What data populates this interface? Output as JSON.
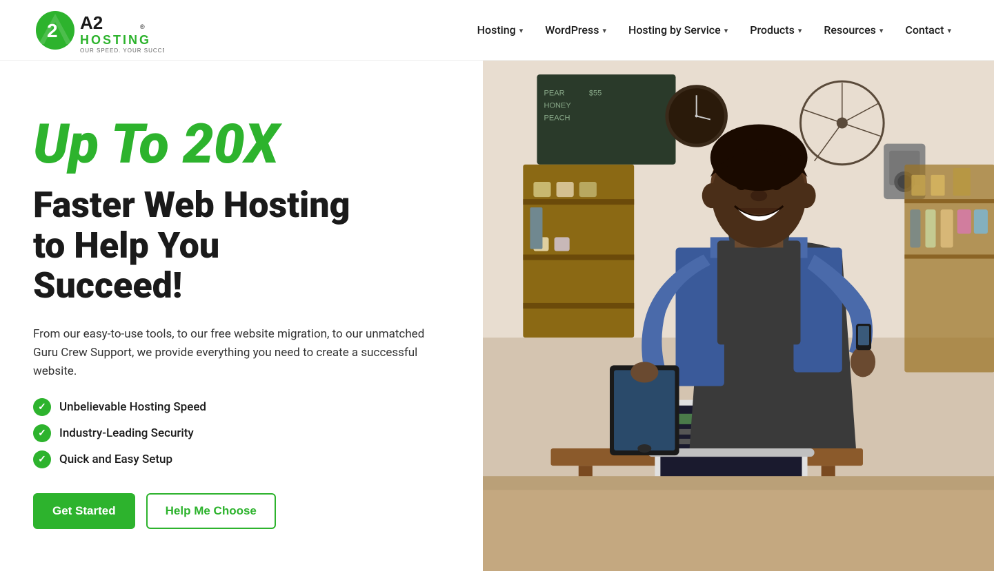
{
  "brand": {
    "name": "A2 HOSTING",
    "tagline": "OUR SPEED, YOUR SUCCESS",
    "logo_color": "#2db32d"
  },
  "nav": {
    "items": [
      {
        "label": "Hosting",
        "has_dropdown": true
      },
      {
        "label": "WordPress",
        "has_dropdown": true
      },
      {
        "label": "Hosting by Service",
        "has_dropdown": true
      },
      {
        "label": "Products",
        "has_dropdown": true
      },
      {
        "label": "Resources",
        "has_dropdown": true
      },
      {
        "label": "Contact",
        "has_dropdown": true
      }
    ]
  },
  "hero": {
    "tagline": "Up To 20X",
    "heading_line1": "Faster Web Hosting",
    "heading_line2": "to Help You",
    "heading_line3": "Succeed!",
    "description": "From our easy-to-use tools, to our free website migration, to our unmatched Guru Crew Support, we provide everything you need to create a successful website.",
    "features": [
      "Unbelievable Hosting Speed",
      "Industry-Leading Security",
      "Quick and Easy Setup"
    ],
    "cta_primary": "Get Started",
    "cta_secondary": "Help Me Choose"
  },
  "colors": {
    "green": "#2db32d",
    "dark": "#1a1a1a",
    "text": "#333333"
  }
}
